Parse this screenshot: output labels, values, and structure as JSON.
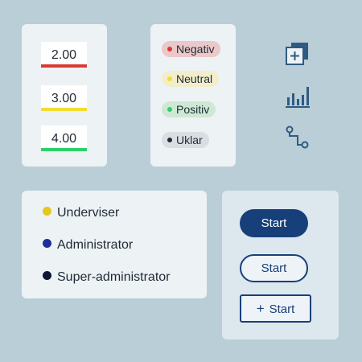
{
  "values": {
    "items": [
      {
        "value": "2.00",
        "color": "#d83a33"
      },
      {
        "value": "3.00",
        "color": "#f4dc34"
      },
      {
        "value": "4.00",
        "color": "#2ecf6c"
      }
    ]
  },
  "tags": {
    "items": [
      {
        "label": "Negativ",
        "dot_color": "#d83a33"
      },
      {
        "label": "Neutral",
        "dot_color": "#f4dc34"
      },
      {
        "label": "Positiv",
        "dot_color": "#2ecf6c"
      },
      {
        "label": "Uklar",
        "dot_color": "#1f2a36"
      }
    ]
  },
  "icons": [
    "add-copy-icon",
    "bar-chart-icon",
    "flow-icon"
  ],
  "roles": {
    "items": [
      {
        "label": "Underviser",
        "color": "#e6c81c"
      },
      {
        "label": "Administrator",
        "color": "#1d2f97"
      },
      {
        "label": "Super-administrator",
        "color": "#0f1736"
      }
    ]
  },
  "buttons": {
    "primary_label": "Start",
    "outline_round_label": "Start",
    "outline_plus_label": "Start",
    "plus_glyph": "+"
  },
  "colors": {
    "background": "#b9ced6",
    "accent": "#17407a"
  }
}
